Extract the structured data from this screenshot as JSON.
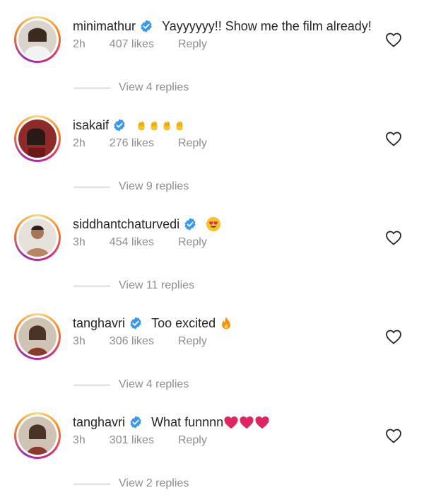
{
  "comments": [
    {
      "username": "minimathur",
      "text": "Yayyyyyy!! Show me the film already!",
      "time": "2h",
      "likes": "407 likes",
      "reply": "Reply",
      "view_replies": "View 4 replies"
    },
    {
      "username": "isakaif",
      "text": "",
      "time": "2h",
      "likes": "276 likes",
      "reply": "Reply",
      "view_replies": "View 9 replies"
    },
    {
      "username": "siddhantchaturvedi",
      "text": "",
      "time": "3h",
      "likes": "454 likes",
      "reply": "Reply",
      "view_replies": "View 11 replies"
    },
    {
      "username": "tanghavri",
      "text": "Too excited",
      "time": "3h",
      "likes": "306 likes",
      "reply": "Reply",
      "view_replies": "View 4 replies"
    },
    {
      "username": "tanghavri",
      "text": "What funnnn",
      "time": "3h",
      "likes": "301 likes",
      "reply": "Reply",
      "view_replies": "View 2 replies"
    }
  ],
  "icons": {
    "verified": "verified-badge-icon",
    "like": "heart-outline-icon",
    "clap": "clapping-hands-emoji",
    "heart_eyes": "heart-eyes-emoji",
    "fire": "fire-emoji",
    "red_heart": "red-heart-emoji"
  },
  "colors": {
    "verified_blue": "#3897f0",
    "muted_text": "#8e8e8e",
    "emoji_yellow": "#f8c32a",
    "heart_red": "#e0245e"
  }
}
